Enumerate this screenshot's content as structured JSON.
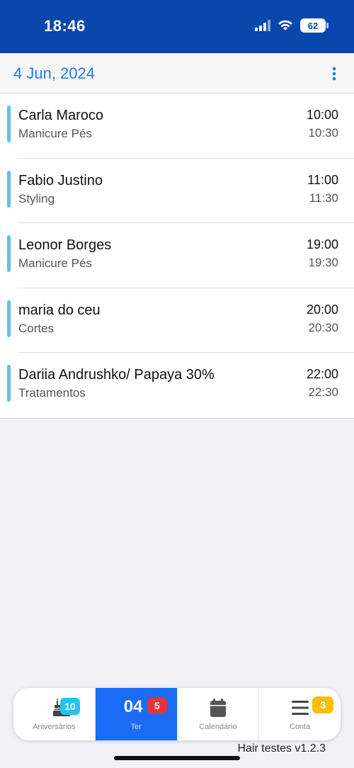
{
  "status": {
    "time": "18:46",
    "battery": "62"
  },
  "header": {
    "date": "4 Jun, 2024"
  },
  "appointments": [
    {
      "client": "Carla Maroco",
      "service": "Manicure Pés",
      "start": "10:00",
      "end": "10:30"
    },
    {
      "client": "Fabio Justino",
      "service": "Styling",
      "start": "11:00",
      "end": "11:30"
    },
    {
      "client": "Leonor Borges",
      "service": "Manicure Pés",
      "start": "19:00",
      "end": "19:30"
    },
    {
      "client": "maria do ceu",
      "service": "Cortes",
      "start": "20:00",
      "end": "20:30"
    },
    {
      "client": "Dariia Andrushko/ Papaya 30%",
      "service": "Tratamentos",
      "start": "22:00",
      "end": "22:30"
    }
  ],
  "tabs": {
    "birthdays": {
      "label": "Aniversários",
      "badge": "10",
      "icon": "cake-icon"
    },
    "today": {
      "label": "Ter",
      "day": "04",
      "badge": "5"
    },
    "calendar": {
      "label": "Calendário",
      "icon": "calendar-icon"
    },
    "account": {
      "label": "Conta",
      "badge": "3",
      "icon": "menu-icon"
    }
  },
  "footer": {
    "version": "Hair testes v1.2.3"
  },
  "colors": {
    "status_bar": "#0a47ad",
    "accent_blue": "#1e7be8",
    "row_marker": "#5cc1ee",
    "active_tab": "#1a6cf5",
    "badge_cyan": "#27c3ee",
    "badge_red": "#e0343f",
    "badge_yellow": "#f6c000"
  }
}
